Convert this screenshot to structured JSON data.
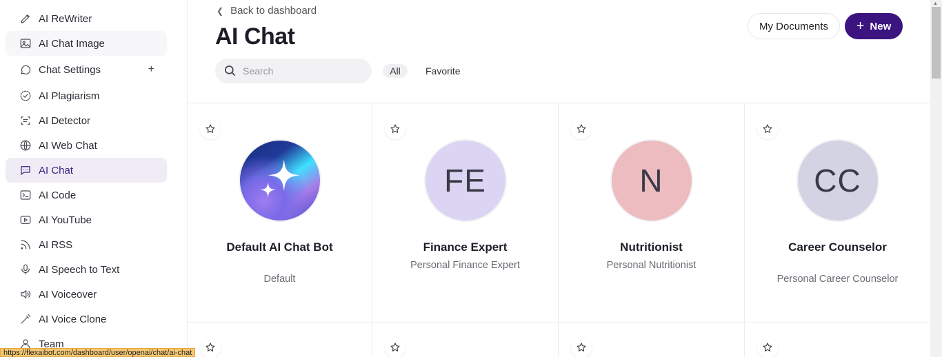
{
  "sidebar": {
    "items": [
      {
        "label": "AI ReWriter",
        "icon": "pen-icon"
      },
      {
        "label": "AI Chat Image",
        "icon": "image-icon"
      },
      {
        "label": "Chat Settings",
        "icon": "chat-bubble-icon"
      },
      {
        "label": "AI Plagiarism",
        "icon": "check-circle-icon"
      },
      {
        "label": "AI Detector",
        "icon": "scan-icon"
      },
      {
        "label": "AI Web Chat",
        "icon": "globe-icon"
      },
      {
        "label": "AI Chat",
        "icon": "chat-square-icon"
      },
      {
        "label": "AI Code",
        "icon": "terminal-icon"
      },
      {
        "label": "AI YouTube",
        "icon": "play-icon"
      },
      {
        "label": "AI RSS",
        "icon": "rss-icon"
      },
      {
        "label": "AI Speech to Text",
        "icon": "microphone-icon"
      },
      {
        "label": "AI Voiceover",
        "icon": "speaker-icon"
      },
      {
        "label": "AI Voice Clone",
        "icon": "wand-icon"
      },
      {
        "label": "Team",
        "icon": "user-icon"
      }
    ],
    "chat_settings_add": "+"
  },
  "header": {
    "back_label": "Back to dashboard",
    "title": "AI Chat",
    "my_documents": "My Documents",
    "new_label": "New"
  },
  "search": {
    "placeholder": "Search",
    "value": ""
  },
  "filters": {
    "all": "All",
    "favorite": "Favorite"
  },
  "cards": [
    {
      "name": "Default AI Chat Bot",
      "desc": "Default",
      "initials": "",
      "avatar_color": "#2a45b5"
    },
    {
      "name": "Finance Expert",
      "desc": "Personal Finance Expert",
      "initials": "FE",
      "avatar_color": "#dcd4f3"
    },
    {
      "name": "Nutritionist",
      "desc": "Personal Nutritionist",
      "initials": "N",
      "avatar_color": "#ecbcc0"
    },
    {
      "name": "Career Counselor",
      "desc": "Personal Career Counselor",
      "initials": "CC",
      "avatar_color": "#d4d3e3"
    }
  ],
  "status_url": "https://flexaibot.com/dashboard/user/openai/chat/ai-chat",
  "colors": {
    "accent": "#3b1480",
    "active_bg": "#efecf6"
  }
}
